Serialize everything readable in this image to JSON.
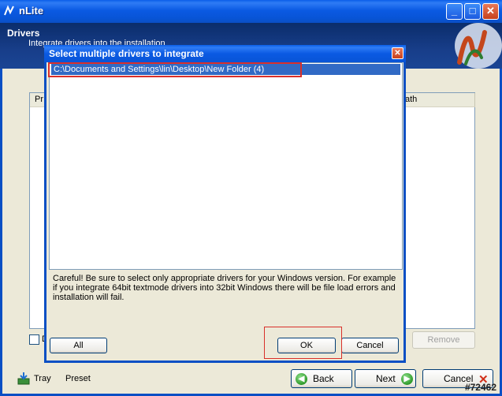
{
  "window": {
    "title": "nLite",
    "minimize": "_",
    "maximize": "□",
    "close": "✕"
  },
  "header": {
    "title": "Drivers",
    "subtitle": "Integrate drivers into the installation"
  },
  "panel": {
    "column_left": "Pr",
    "column_right": "ath",
    "checkbox_label": "D",
    "remove_button": "Remove"
  },
  "bottom": {
    "tray_label": "Tray",
    "preset_label": "Preset",
    "back_label": "Back",
    "next_label": "Next",
    "cancel_label": "Cancel",
    "watermark": "#72462"
  },
  "dialog": {
    "title": "Select multiple drivers to integrate",
    "close": "✕",
    "items": [
      "C:\\Documents and Settings\\lin\\Desktop\\New Folder (4)"
    ],
    "message": "Careful! Be sure to select only appropriate drivers for your Windows version. For example if you integrate 64bit textmode drivers into 32bit Windows there will be file load errors and installation will fail.",
    "all_button": "All",
    "ok_button": "OK",
    "cancel_button": "Cancel"
  },
  "colors": {
    "titlebar": "#0a5ee8",
    "header": "#0b2d6b",
    "selection": "#316ac5",
    "highlight_box": "#d9302a"
  },
  "icons": [
    "nlite-icon",
    "minimize-icon",
    "maximize-icon",
    "close-icon",
    "nlite-logo",
    "tray-icon",
    "back-arrow-icon",
    "next-arrow-icon",
    "cancel-x-icon"
  ]
}
